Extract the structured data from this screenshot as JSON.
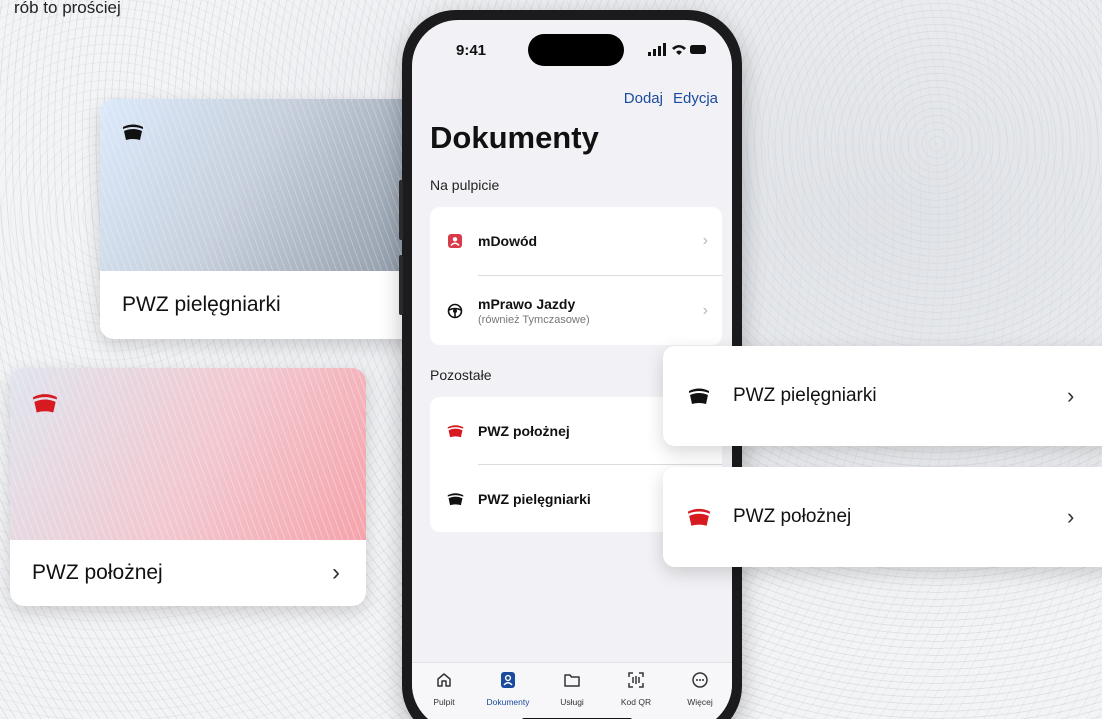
{
  "tagline": "rób to prościej",
  "cards": {
    "nurse": {
      "label": "PWZ pielęgniarki"
    },
    "midwife": {
      "label": "PWZ położnej",
      "chevron": "›"
    }
  },
  "phone": {
    "time": "9:41",
    "actions": {
      "add": "Dodaj",
      "edit": "Edycja"
    },
    "title": "Dokumenty",
    "sections": {
      "desktop": {
        "label": "Na pulpicie",
        "items": [
          {
            "title": "mDowód",
            "icon": "id-card-icon"
          },
          {
            "title": "mPrawo Jazdy",
            "subtitle": "(również Tymczasowe)",
            "icon": "steering-wheel-icon"
          }
        ]
      },
      "other": {
        "label": "Pozostałe",
        "items": [
          {
            "title": "PWZ położnej",
            "icon": "cap-red-icon"
          },
          {
            "title": "PWZ pielęgniarki",
            "icon": "cap-black-icon"
          }
        ]
      }
    },
    "tabs": [
      {
        "label": "Pulpit",
        "icon": "home-icon"
      },
      {
        "label": "Dokumenty",
        "icon": "documents-icon",
        "active": true
      },
      {
        "label": "Usługi",
        "icon": "folder-icon"
      },
      {
        "label": "Kod QR",
        "icon": "qr-scan-icon"
      },
      {
        "label": "Więcej",
        "icon": "more-icon"
      }
    ]
  },
  "floating": {
    "nurse": {
      "label": "PWZ pielęgniarki",
      "chevron": "›"
    },
    "midwife": {
      "label": "PWZ położnej",
      "chevron": "›"
    }
  },
  "colors": {
    "accent": "#1a4a9c",
    "midwife_red": "#d71920",
    "id_red": "#d93a4a"
  }
}
